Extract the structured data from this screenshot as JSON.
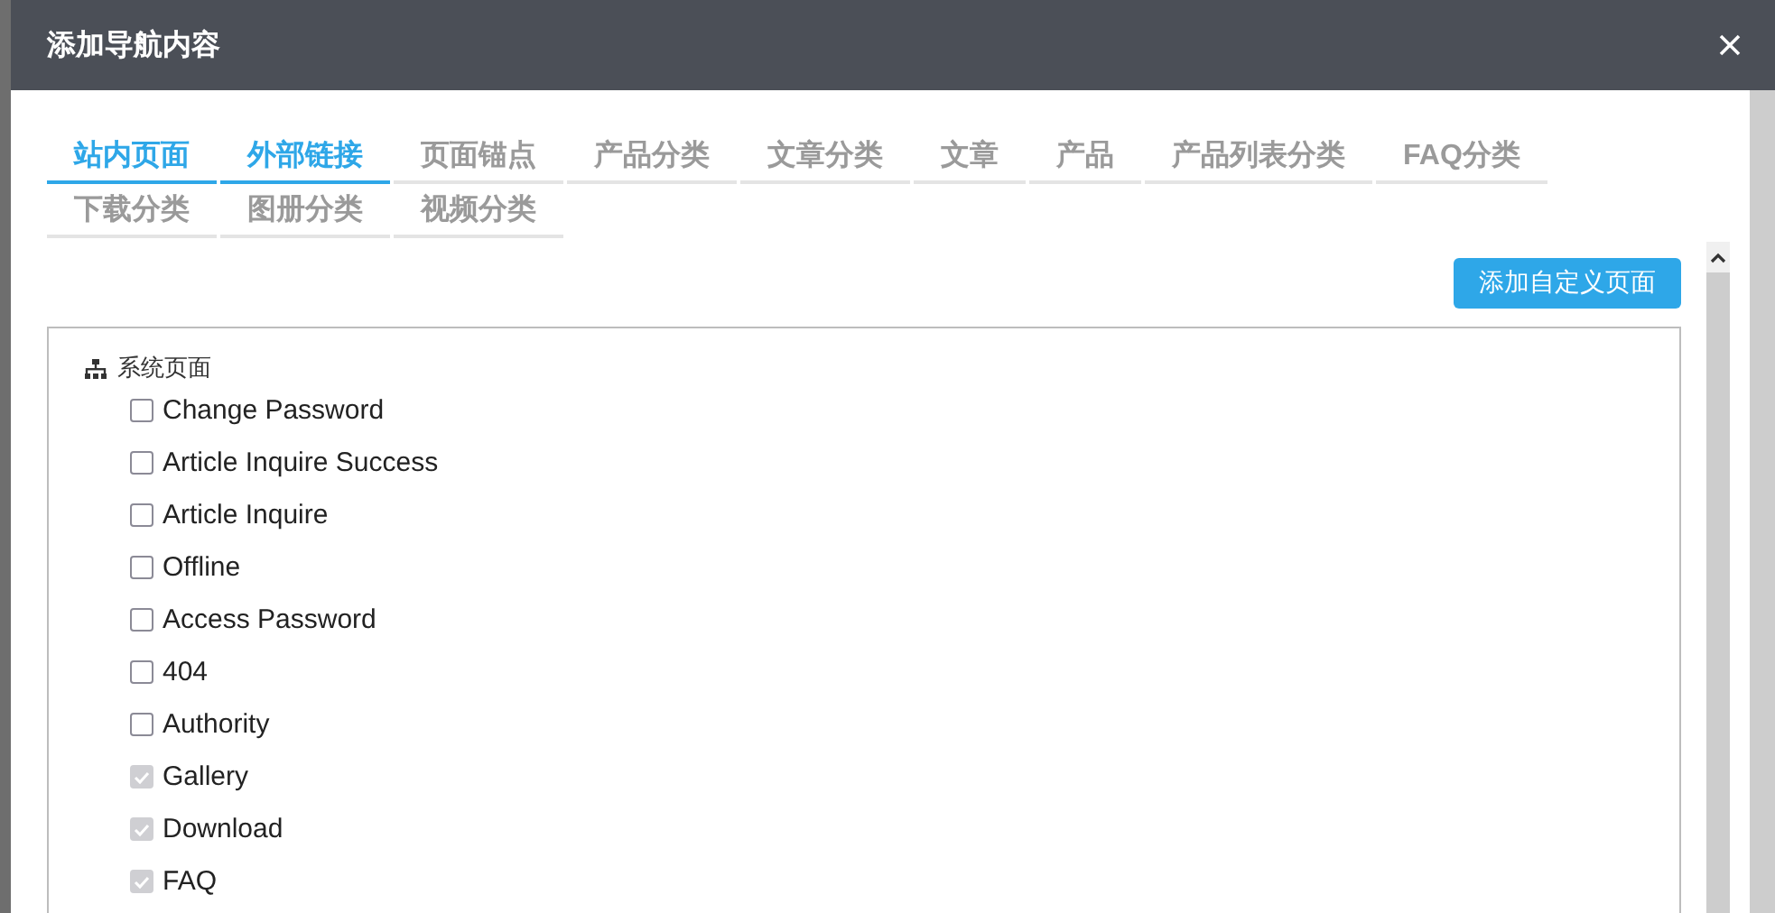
{
  "dialog": {
    "title": "添加导航内容"
  },
  "tabs": [
    {
      "label": "站内页面",
      "selected": true
    },
    {
      "label": "外部链接",
      "selected": true
    },
    {
      "label": "页面锚点",
      "selected": false
    },
    {
      "label": "产品分类",
      "selected": false
    },
    {
      "label": "文章分类",
      "selected": false
    },
    {
      "label": "文章",
      "selected": false
    },
    {
      "label": "产品",
      "selected": false
    },
    {
      "label": "产品列表分类",
      "selected": false
    },
    {
      "label": "FAQ分类",
      "selected": false
    },
    {
      "label": "下载分类",
      "selected": false
    },
    {
      "label": "图册分类",
      "selected": false
    },
    {
      "label": "视频分类",
      "selected": false
    }
  ],
  "add_button": "添加自定义页面",
  "tree": {
    "label": "系统页面",
    "children": [
      {
        "label": "Change Password",
        "checked": false,
        "disabled": false
      },
      {
        "label": "Article Inquire Success",
        "checked": false,
        "disabled": false
      },
      {
        "label": "Article Inquire",
        "checked": false,
        "disabled": false
      },
      {
        "label": "Offline",
        "checked": false,
        "disabled": false
      },
      {
        "label": "Access Password",
        "checked": false,
        "disabled": false
      },
      {
        "label": "404",
        "checked": false,
        "disabled": false
      },
      {
        "label": "Authority",
        "checked": false,
        "disabled": false
      },
      {
        "label": "Gallery",
        "checked": true,
        "disabled": true
      },
      {
        "label": "Download",
        "checked": true,
        "disabled": true
      },
      {
        "label": "FAQ",
        "checked": true,
        "disabled": true
      }
    ]
  }
}
